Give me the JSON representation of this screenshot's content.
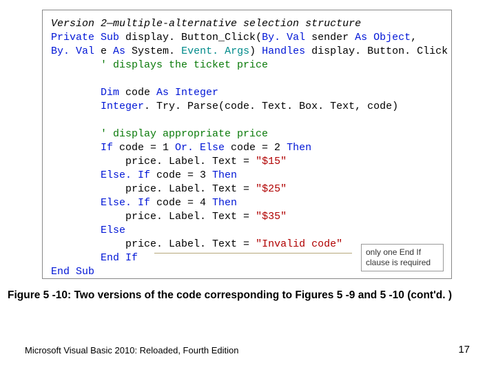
{
  "header": {
    "version_label": "Version 2",
    "version_desc": "—multiple-alternative selection structure"
  },
  "code": {
    "l1_a": "Private Sub",
    "l1_b": " display. Button_Click(",
    "l1_c": "By. Val",
    "l1_d": " sender ",
    "l1_e": "As Object",
    "l1_f": ",",
    "l2_a": "By. Val",
    "l2_b": " e ",
    "l2_c": "As",
    "l2_d": " System. ",
    "l2_e": "Event. Args",
    "l2_f": ") ",
    "l2_g": "Handles",
    "l2_h": " display. Button. Click",
    "l3": "        ' displays the ticket price",
    "l5_a": "        Dim",
    "l5_b": " code ",
    "l5_c": "As Integer",
    "l6_a": "        Integer",
    "l6_b": ". Try. Parse(code. Text. Box. Text, code)",
    "l8": "        ' display appropriate price",
    "l9_a": "        If",
    "l9_b": " code = 1 ",
    "l9_c": "Or. Else",
    "l9_d": " code = 2 ",
    "l9_e": "Then",
    "l10_a": "            price. Label. Text = ",
    "l10_b": "\"$15\"",
    "l11_a": "        Else. If",
    "l11_b": " code = 3 ",
    "l11_c": "Then",
    "l12_a": "            price. Label. Text = ",
    "l12_b": "\"$25\"",
    "l13_a": "        Else. If",
    "l13_b": " code = 4 ",
    "l13_c": "Then",
    "l14_a": "            price. Label. Text = ",
    "l14_b": "\"$35\"",
    "l15": "        Else",
    "l16_a": "            price. Label. Text = ",
    "l16_b": "\"Invalid code\"",
    "l17": "        End If",
    "l18": "End Sub"
  },
  "callout": "only one End If clause is required",
  "caption": "Figure 5 -10: Two versions of the code corresponding to Figures 5 -9 and 5 -10 (cont'd. )",
  "footer": {
    "left": "Microsoft Visual Basic 2010: Reloaded, Fourth Edition",
    "right": "17"
  }
}
